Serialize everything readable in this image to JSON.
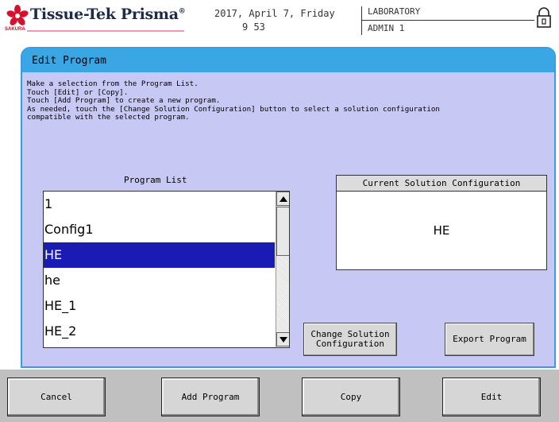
{
  "header": {
    "logo_text": "Tissue-Tek Prisma",
    "logo_reg": "®",
    "logo_sub": "SAKURA",
    "date": "2017, April 7, Friday",
    "time": "9 53",
    "lab": "LABORATORY",
    "user": "ADMIN 1",
    "lock_icon": "padlock-icon",
    "logo_color": "#c8102e"
  },
  "panel": {
    "title": "Edit Program",
    "instructions": [
      "Make a selection from the Program List.",
      "Touch [Edit] or [Copy].",
      "Touch [Add Program] to create a new program.",
      "As needed, touch the [Change Solution Configuration] button to select a solution configuration",
      "compatible with the selected program."
    ],
    "program_list_label": "Program List",
    "program_list": {
      "items": [
        "1",
        "Config1",
        "HE",
        "he",
        "HE_1",
        "HE_2"
      ],
      "selected_index": 2
    },
    "solution_header": "Current Solution Configuration",
    "solution_value": "HE",
    "change_solution_label": [
      "Change Solution",
      "Configuration"
    ],
    "export_label": "Export Program"
  },
  "footer": {
    "cancel": "Cancel",
    "add_program": "Add Program",
    "copy": "Copy",
    "edit": "Edit"
  },
  "colors": {
    "title_bar": "#3aa6e4",
    "panel_bg": "#c8c8f4",
    "selection": "#1a1ab4"
  }
}
